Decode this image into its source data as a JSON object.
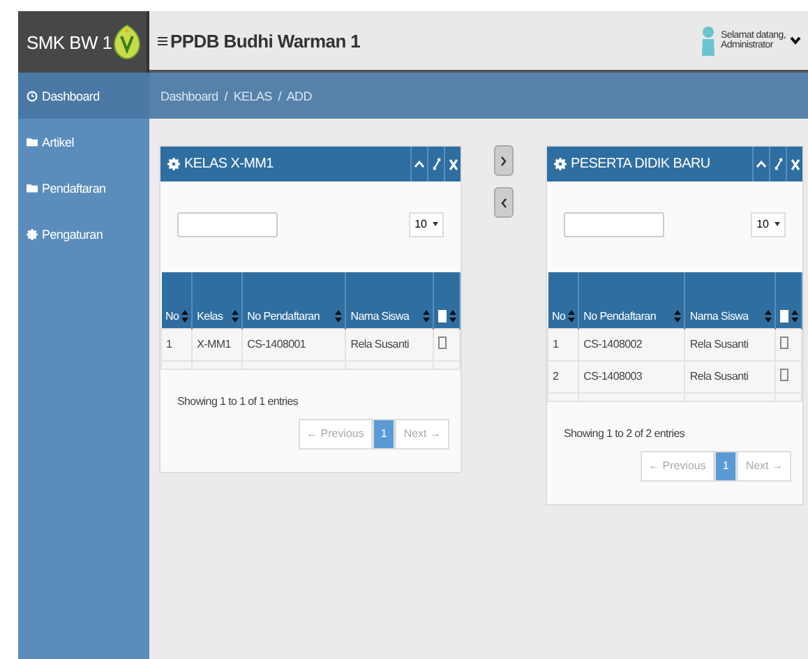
{
  "header": {
    "brand": "SMK BW 1",
    "title": "PPDB Budhi Warman 1",
    "greeting": "Selamat datang,",
    "user": "Administrator"
  },
  "sidebar": {
    "items": [
      {
        "label": "Dashboard",
        "kind": "clock",
        "selected": true
      },
      {
        "label": "Artikel",
        "kind": "folder",
        "selected": false
      },
      {
        "label": "Pendaftaran",
        "kind": "folder",
        "selected": false
      },
      {
        "label": "Pengaturan",
        "kind": "gear",
        "selected": false
      }
    ]
  },
  "breadcrumb": "Dashboard  /  KELAS  /  ADD",
  "panels": [
    {
      "title": "KELAS X-MM1",
      "page_size": "10",
      "columns": [
        {
          "label": "No"
        },
        {
          "label": "Kelas"
        },
        {
          "label": "No Pendaftaran"
        },
        {
          "label": "Nama Siswa"
        },
        {
          "kind": "check",
          "checked": false
        }
      ],
      "rows": [
        {
          "cells": [
            "1",
            "X-MM1",
            "CS-1408001",
            "Rela Susanti"
          ],
          "checked": false
        }
      ],
      "info": "Showing 1 to 1 of 1 entries",
      "previous": "← Previous",
      "pages": [
        {
          "label": "1",
          "selected": true
        }
      ],
      "next": "Next →"
    },
    {
      "title": "PESERTA DIDIK BARU",
      "page_size": "10",
      "columns": [
        {
          "label": "No"
        },
        {
          "label": "No Pendaftaran"
        },
        {
          "label": "Nama Siswa"
        },
        {
          "kind": "check",
          "checked": false
        }
      ],
      "rows": [
        {
          "cells": [
            "1",
            "CS-1408002",
            "Rela Susanti"
          ],
          "checked": false
        },
        {
          "cells": [
            "2",
            "CS-1408003",
            "Rela Susanti"
          ],
          "checked": false
        }
      ],
      "info": "Showing 1 to 2 of 2 entries",
      "previous": "← Previous",
      "pages": [
        {
          "label": "1",
          "selected": true
        }
      ],
      "next": "Next →"
    }
  ]
}
